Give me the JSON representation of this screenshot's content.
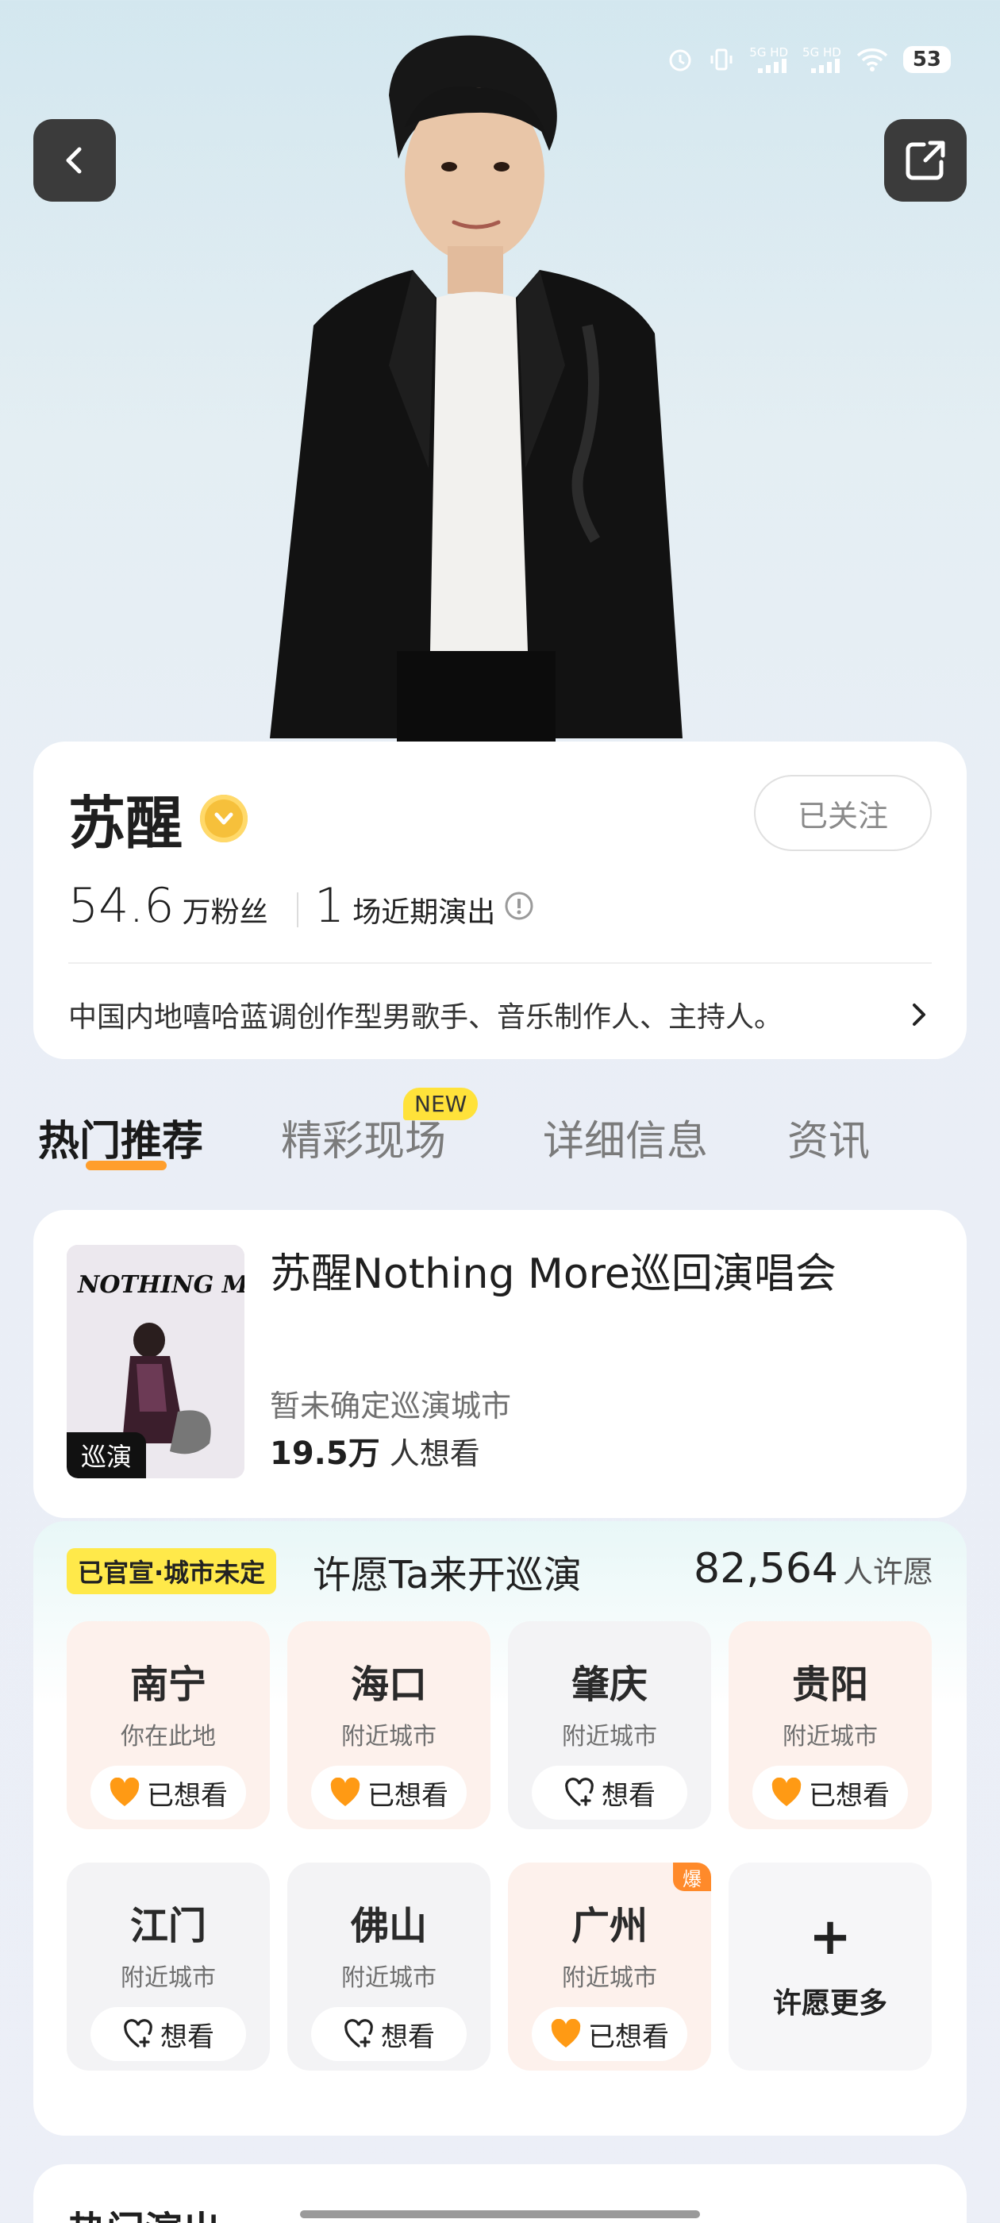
{
  "status_bar": {
    "network1": "5G HD",
    "network2": "5G HD",
    "battery": "53"
  },
  "artist": {
    "name": "苏醒",
    "follow_label": "已关注",
    "fans_num": "54.6",
    "fans_label": "万粉丝",
    "shows_num": "1",
    "shows_label": "场近期演出",
    "bio": "中国内地嘻哈蓝调创作型男歌手、音乐制作人、主持人。"
  },
  "tabs": [
    {
      "label": "热门推荐"
    },
    {
      "label": "精彩现场"
    },
    {
      "label": "详细信息"
    },
    {
      "label": "资讯"
    }
  ],
  "new_badge": "NEW",
  "show": {
    "title": "苏醒Nothing More巡回演唱会",
    "poster_tag": "巡演",
    "poster_text": "NOTHING MORE",
    "city_status": "暂未确定巡演城市",
    "want_count": "19.5万",
    "want_label": "人想看"
  },
  "wish": {
    "tag": "已官宣·城市未定",
    "title": "许愿Ta来开巡演",
    "count": "82,564",
    "count_label": "人许愿",
    "more_label": "许愿更多",
    "more_plus": "+",
    "hot_badge": "爆",
    "cities": [
      {
        "name": "南宁",
        "sub": "你在此地",
        "action": "已想看",
        "state": "wanted"
      },
      {
        "name": "海口",
        "sub": "附近城市",
        "action": "已想看",
        "state": "wanted"
      },
      {
        "name": "肇庆",
        "sub": "附近城市",
        "action": "想看",
        "state": "not"
      },
      {
        "name": "贵阳",
        "sub": "附近城市",
        "action": "已想看",
        "state": "wanted"
      },
      {
        "name": "江门",
        "sub": "附近城市",
        "action": "想看",
        "state": "not"
      },
      {
        "name": "佛山",
        "sub": "附近城市",
        "action": "想看",
        "state": "not"
      },
      {
        "name": "广州",
        "sub": "附近城市",
        "action": "已想看",
        "state": "wanted"
      }
    ]
  },
  "next_section_title": "热门演出",
  "colors": {
    "accent_orange": "#ff9e2c",
    "heart_orange": "#ff9a14",
    "tag_yellow": "#ffe94a",
    "verify_gold": "#f6c03b"
  }
}
